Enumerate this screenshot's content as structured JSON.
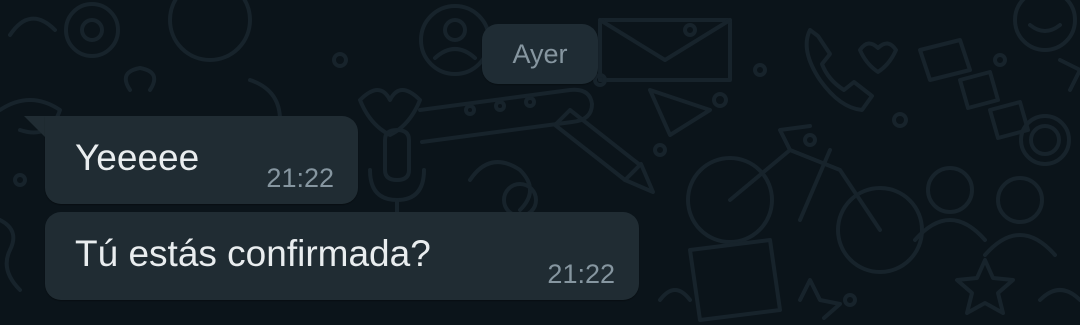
{
  "chat": {
    "date_chip": "Ayer",
    "messages": [
      {
        "text": "Yeeeee",
        "time": "21:22",
        "direction": "incoming"
      },
      {
        "text": "Tú estás confirmada?",
        "time": "21:22",
        "direction": "incoming"
      }
    ]
  },
  "colors": {
    "background": "#0b141a",
    "bubble_incoming": "#202c33",
    "date_chip": "#1f2c34",
    "text_primary": "#e9edef",
    "text_secondary": "#8696a0"
  }
}
